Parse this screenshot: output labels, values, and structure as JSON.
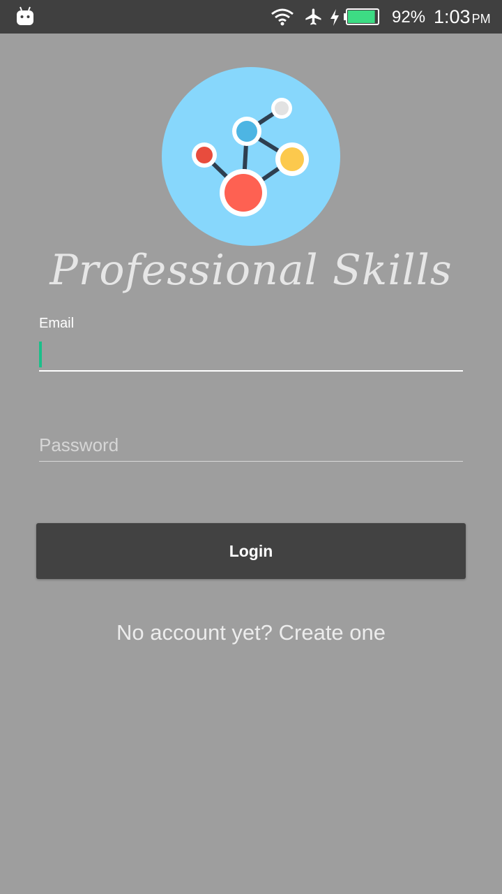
{
  "status_bar": {
    "notification_icon": "android-robot-icon",
    "wifi_icon": "wifi-icon",
    "airplane_icon": "airplane-icon",
    "charging_icon": "charging-bolt-icon",
    "battery_icon": "battery-icon",
    "battery_level": 0.92,
    "battery_percent": "92%",
    "time": "1:03",
    "ampm": "PM"
  },
  "logo": {
    "icon": "molecule-network-icon",
    "colors": {
      "circle": "#87d7fc",
      "red_small": "#e84c3d",
      "blue": "#4db5e3",
      "yellow": "#fcc94d",
      "red_large": "#fe6152",
      "grey": "#e2e2e2",
      "lines": "#2e3f50"
    }
  },
  "app_title": "Professional Skills",
  "form": {
    "email_label": "Email",
    "email_value": "",
    "password_placeholder": "Password",
    "password_value": "",
    "login_label": "Login",
    "signup_text": "No account yet? Create one"
  },
  "colors": {
    "background": "#9e9e9e",
    "status_bar": "#404040",
    "button": "#424242",
    "cursor_accent": "#1bbf8a",
    "battery_fill": "#3ddc84"
  }
}
